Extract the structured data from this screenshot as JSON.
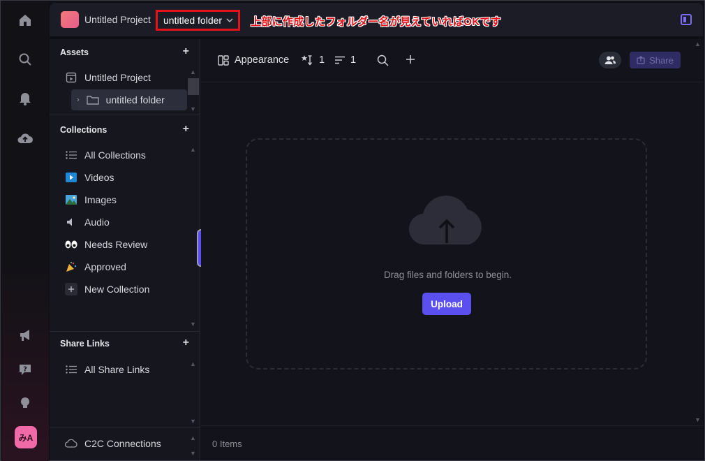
{
  "topbar": {
    "project_name": "Untitled Project",
    "folder_name": "untitled folder",
    "annotation": "上部に作成したフォルダー名が見えていればOKです"
  },
  "rail": {
    "avatar_text": "みA",
    "icons": [
      "home-icon",
      "search-icon",
      "bell-icon",
      "cloud-upload-icon",
      "megaphone-icon",
      "help-icon",
      "lightbulb-icon"
    ]
  },
  "sidebar": {
    "assets": {
      "title": "Assets",
      "items": [
        {
          "label": "Untitled Project",
          "icon": "project-icon"
        },
        {
          "label": "untitled folder",
          "icon": "folder-icon"
        }
      ]
    },
    "collections": {
      "title": "Collections",
      "items": [
        {
          "label": "All Collections",
          "icon": "list-icon"
        },
        {
          "label": "Videos",
          "icon": "▶️"
        },
        {
          "label": "Images",
          "icon": "🏞️"
        },
        {
          "label": "Audio",
          "icon": "🔈"
        },
        {
          "label": "Needs Review",
          "icon": "👀"
        },
        {
          "label": "Approved",
          "icon": "🎉"
        },
        {
          "label": "New Collection",
          "icon": "+"
        }
      ]
    },
    "share_links": {
      "title": "Share Links",
      "items": [
        {
          "label": "All Share Links",
          "icon": "list-icon"
        }
      ]
    },
    "c2c": {
      "label": "C2C Connections"
    }
  },
  "toolbar": {
    "appearance_label": "Appearance",
    "sort_count": "1",
    "filter_count": "1",
    "share_label": "Share"
  },
  "main": {
    "drop_text": "Drag files and folders to begin.",
    "upload_label": "Upload",
    "items_count": "0 Items"
  },
  "colors": {
    "accent": "#5b4ff0",
    "annotation_red": "#e4121a",
    "background": "#13141b"
  }
}
